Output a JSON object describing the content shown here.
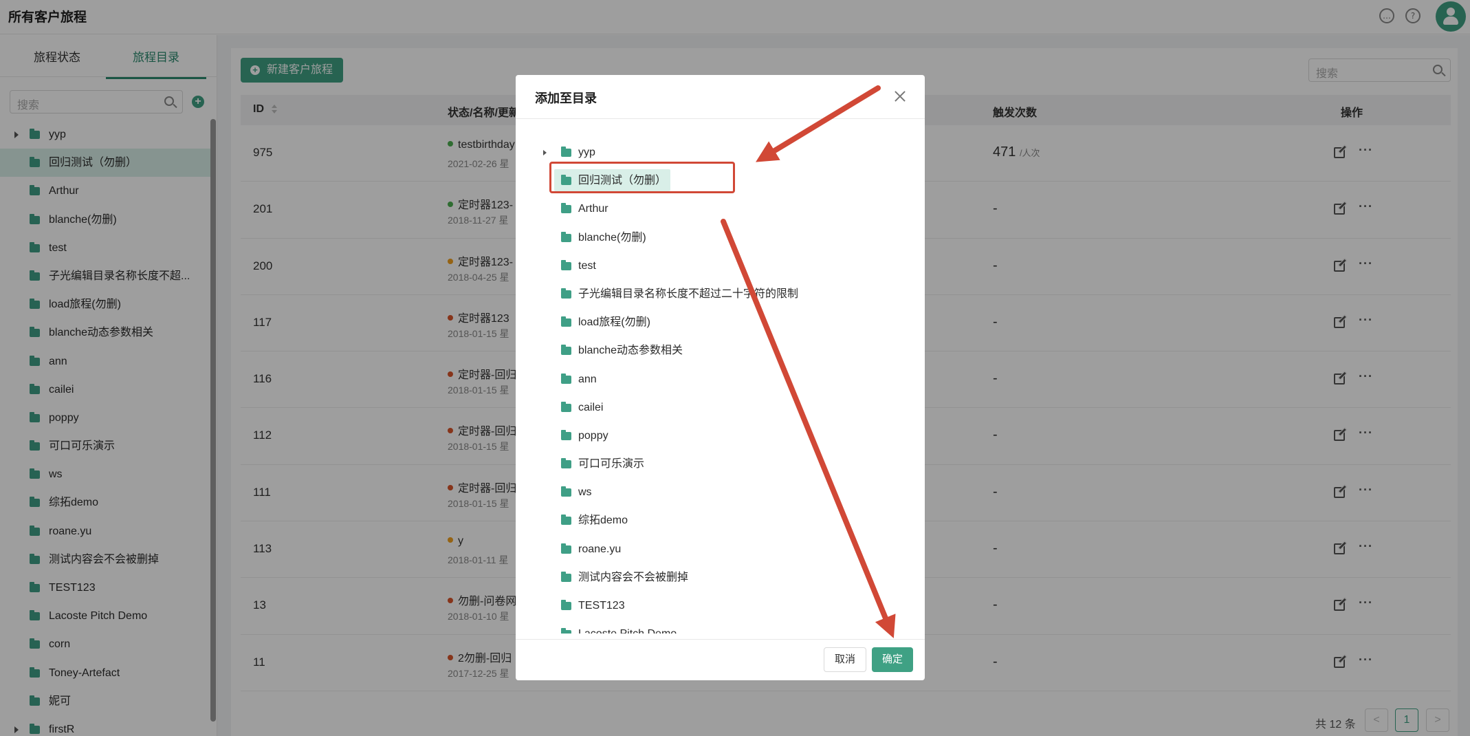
{
  "app": {
    "title": "所有客户旅程"
  },
  "colors": {
    "accent": "#3fa184",
    "annotation": "#d14836",
    "status_green": "#4caf50",
    "status_orange": "#f0a020",
    "status_red": "#d9542b"
  },
  "topbar": {
    "icons": [
      "message-icon",
      "help-icon",
      "user-avatar"
    ]
  },
  "sidebar": {
    "tabs": [
      {
        "label": "旅程状态",
        "active": false
      },
      {
        "label": "旅程目录",
        "active": true
      }
    ],
    "search_placeholder": "搜索",
    "items": [
      {
        "label": "yyp",
        "expandable": true
      },
      {
        "label": "回归测试（勿删）",
        "selected": true
      },
      {
        "label": "Arthur"
      },
      {
        "label": "blanche(勿删)"
      },
      {
        "label": "test"
      },
      {
        "label": "子光编辑目录名称长度不超..."
      },
      {
        "label": "load旅程(勿删)"
      },
      {
        "label": "blanche动态参数相关"
      },
      {
        "label": "ann"
      },
      {
        "label": "cailei"
      },
      {
        "label": "poppy"
      },
      {
        "label": "可口可乐演示"
      },
      {
        "label": "ws"
      },
      {
        "label": "综拓demo"
      },
      {
        "label": "roane.yu"
      },
      {
        "label": "测试内容会不会被删掉"
      },
      {
        "label": "TEST123"
      },
      {
        "label": "Lacoste Pitch Demo"
      },
      {
        "label": "corn"
      },
      {
        "label": "Toney-Artefact"
      },
      {
        "label": "妮可"
      },
      {
        "label": "firstR",
        "expandable": true
      }
    ]
  },
  "main": {
    "new_button": "新建客户旅程",
    "search_placeholder": "搜索",
    "columns": {
      "id": "ID",
      "name": "状态/名称/更新",
      "triggers": "触发次数",
      "actions": "操作"
    },
    "rows": [
      {
        "id": "975",
        "name": "testbirthday",
        "date": "2021-02-26 星",
        "status": "green",
        "count": "471",
        "unit": "/人次"
      },
      {
        "id": "201",
        "name": "定时器123-",
        "date": "2018-11-27 星",
        "status": "green",
        "count": "-"
      },
      {
        "id": "200",
        "name": "定时器123-",
        "date": "2018-04-25 星",
        "status": "orange",
        "count": "-"
      },
      {
        "id": "117",
        "name": "定时器123",
        "date": "2018-01-15 星",
        "status": "red",
        "count": "-"
      },
      {
        "id": "116",
        "name": "定时器-回归",
        "date": "2018-01-15 星",
        "status": "red",
        "count": "-"
      },
      {
        "id": "112",
        "name": "定时器-回归",
        "date": "2018-01-15 星",
        "status": "red",
        "count": "-"
      },
      {
        "id": "111",
        "name": "定时器-回归",
        "date": "2018-01-15 星",
        "status": "red",
        "count": "-"
      },
      {
        "id": "113",
        "name": "y",
        "date": "2018-01-11 星",
        "status": "orange",
        "count": "-"
      },
      {
        "id": "13",
        "name": "勿删-问卷网",
        "date": "2018-01-10 星",
        "status": "red",
        "count": "-"
      },
      {
        "id": "11",
        "name": "2勿删-回归",
        "date": "2017-12-25 星",
        "status": "red",
        "count": "-"
      }
    ],
    "pagination": {
      "total": "共 12 条",
      "prev": "<",
      "current": "1",
      "next": ">"
    }
  },
  "modal": {
    "title": "添加至目录",
    "items": [
      {
        "label": "yyp",
        "expandable": true
      },
      {
        "label": "回归测试（勿删）",
        "selected": true
      },
      {
        "label": "Arthur"
      },
      {
        "label": "blanche(勿删)"
      },
      {
        "label": "test"
      },
      {
        "label": "子光编辑目录名称长度不超过二十字符的限制"
      },
      {
        "label": "load旅程(勿删)"
      },
      {
        "label": "blanche动态参数相关"
      },
      {
        "label": "ann"
      },
      {
        "label": "cailei"
      },
      {
        "label": "poppy"
      },
      {
        "label": "可口可乐演示"
      },
      {
        "label": "ws"
      },
      {
        "label": "综拓demo"
      },
      {
        "label": "roane.yu"
      },
      {
        "label": "测试内容会不会被删掉"
      },
      {
        "label": "TEST123"
      },
      {
        "label": "Lacoste Pitch Demo"
      }
    ],
    "cancel_label": "取消",
    "ok_label": "确定"
  }
}
